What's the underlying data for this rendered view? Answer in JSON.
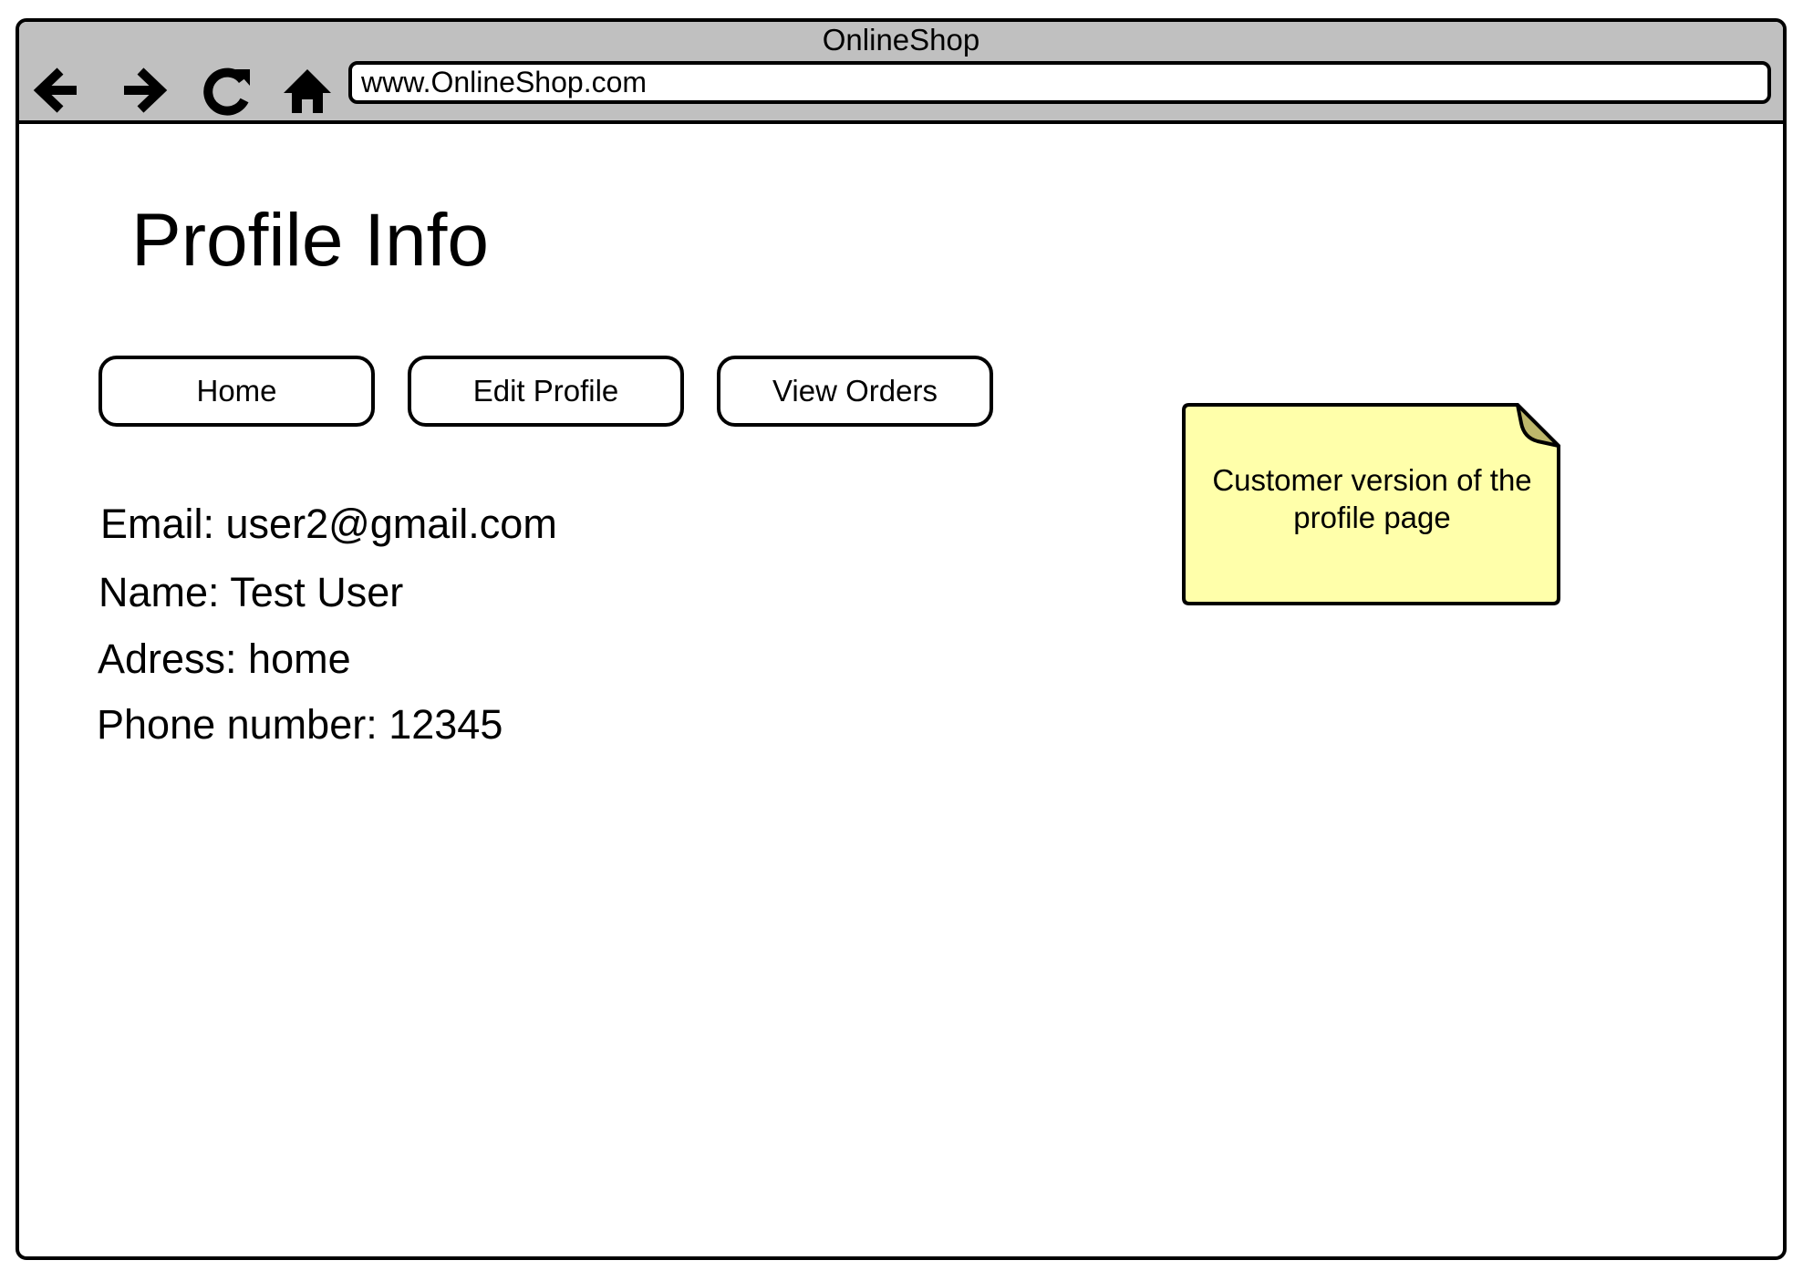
{
  "browser": {
    "window_title": "OnlineShop",
    "url": "www.OnlineShop.com",
    "nav_icons": [
      "back-arrow-icon",
      "forward-arrow-icon",
      "reload-icon",
      "home-icon"
    ]
  },
  "page": {
    "title": "Profile Info",
    "buttons": {
      "home": "Home",
      "edit_profile": "Edit Profile",
      "view_orders": "View Orders"
    },
    "info": {
      "email": "Email: user2@gmail.com",
      "name": "Name: Test User",
      "address": "Adress: home",
      "phone": "Phone number: 12345"
    }
  },
  "note": {
    "text_line1": "Customer version of the",
    "text_line2": "profile page",
    "color": "#ffffaa"
  }
}
